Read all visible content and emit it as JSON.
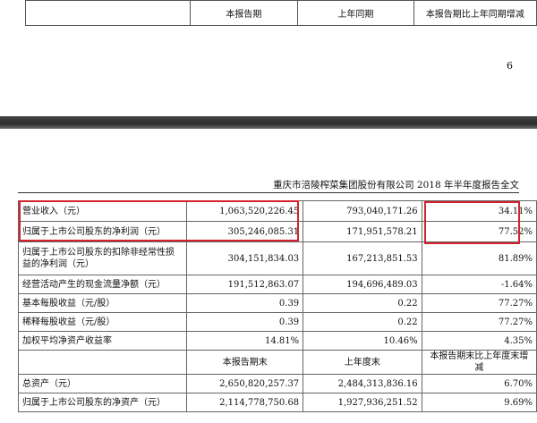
{
  "top_table": {
    "headers": [
      "",
      "本报告期",
      "上年同期",
      "本报告期比上年同期增减"
    ]
  },
  "page_number": "6",
  "doc_header": "重庆市涪陵榨菜集团股份有限公司 2018 年半年度报告全文",
  "financial_table": {
    "rows": [
      {
        "label": "营业收入（元）",
        "current": "1,063,520,226.45",
        "previous": "793,040,171.26",
        "change": "34.11%"
      },
      {
        "label": "归属于上市公司股东的净利润（元）",
        "current": "305,246,085.31",
        "previous": "171,951,578.21",
        "change": "77.52%"
      },
      {
        "label": "归属于上市公司股东的扣除非经常性损益的净利润（元）",
        "current": "304,151,834.03",
        "previous": "167,213,851.53",
        "change": "81.89%"
      },
      {
        "label": "经营活动产生的现金流量净额（元）",
        "current": "191,512,863.07",
        "previous": "194,696,489.03",
        "change": "-1.64%"
      },
      {
        "label": "基本每股收益（元/股）",
        "current": "0.39",
        "previous": "0.22",
        "change": "77.27%"
      },
      {
        "label": "稀释每股收益（元/股）",
        "current": "0.39",
        "previous": "0.22",
        "change": "77.27%"
      },
      {
        "label": "加权平均净资产收益率",
        "current": "14.81%",
        "previous": "10.46%",
        "change": "4.35%"
      }
    ],
    "subheader": [
      "",
      "本报告期末",
      "上年度末",
      "本报告期末比上年度末增减"
    ],
    "rows2": [
      {
        "label": "总资产（元）",
        "current": "2,650,820,257.37",
        "previous": "2,484,313,836.16",
        "change": "6.70%"
      },
      {
        "label": "归属于上市公司股东的净资产（元）",
        "current": "2,114,778,750.68",
        "previous": "1,927,936,251.52",
        "change": "9.69%"
      }
    ]
  },
  "highlight_color": "#d4232e"
}
